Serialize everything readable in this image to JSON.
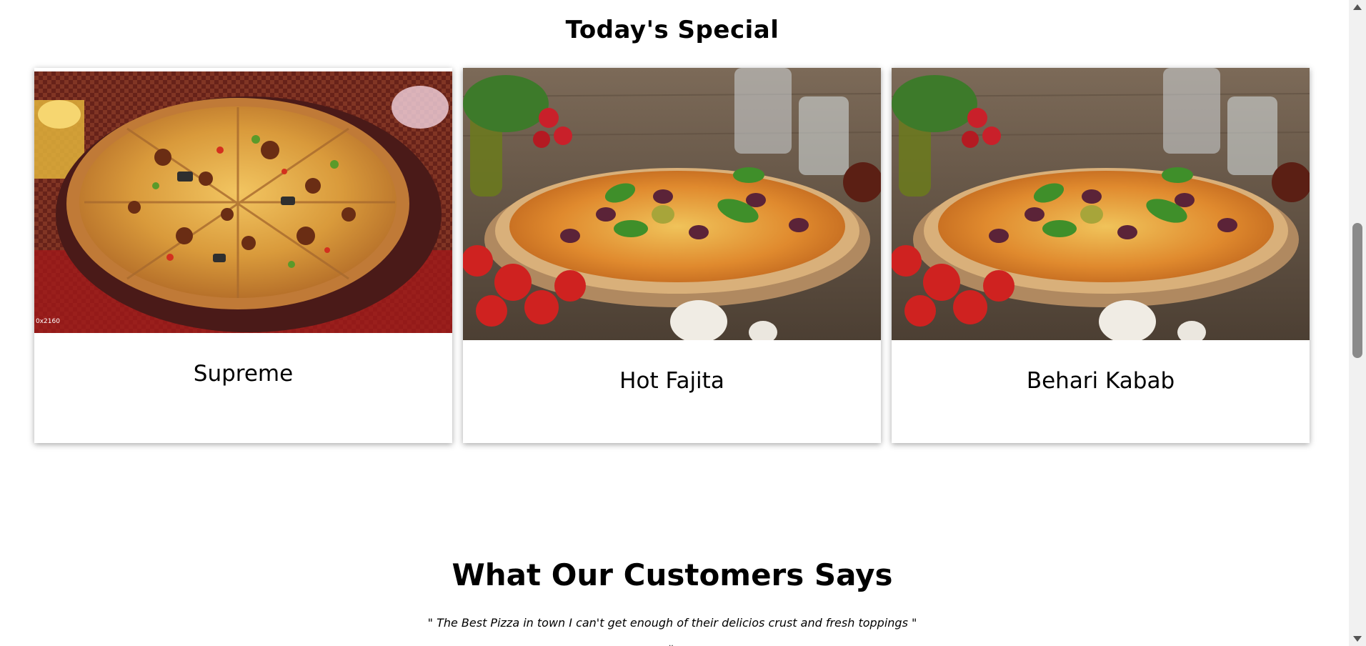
{
  "specials": {
    "title": "Today's Special",
    "items": [
      {
        "name": "Supreme",
        "image": "supreme-pizza-image",
        "image_caption": "0x2160"
      },
      {
        "name": "Hot Fajita",
        "image": "hot-fajita-pizza-image"
      },
      {
        "name": "Behari Kabab",
        "image": "behari-kabab-pizza-image"
      }
    ]
  },
  "testimonials": {
    "title": "What Our Customers Says",
    "quote": "\" The Best Pizza in town I can't get enough of their delicios crust and fresh toppings \""
  },
  "colors": {
    "background": "#ffffff",
    "text": "#000000",
    "scrollbar_track": "#f1f1f1",
    "scrollbar_thumb": "#8a8a8a"
  }
}
